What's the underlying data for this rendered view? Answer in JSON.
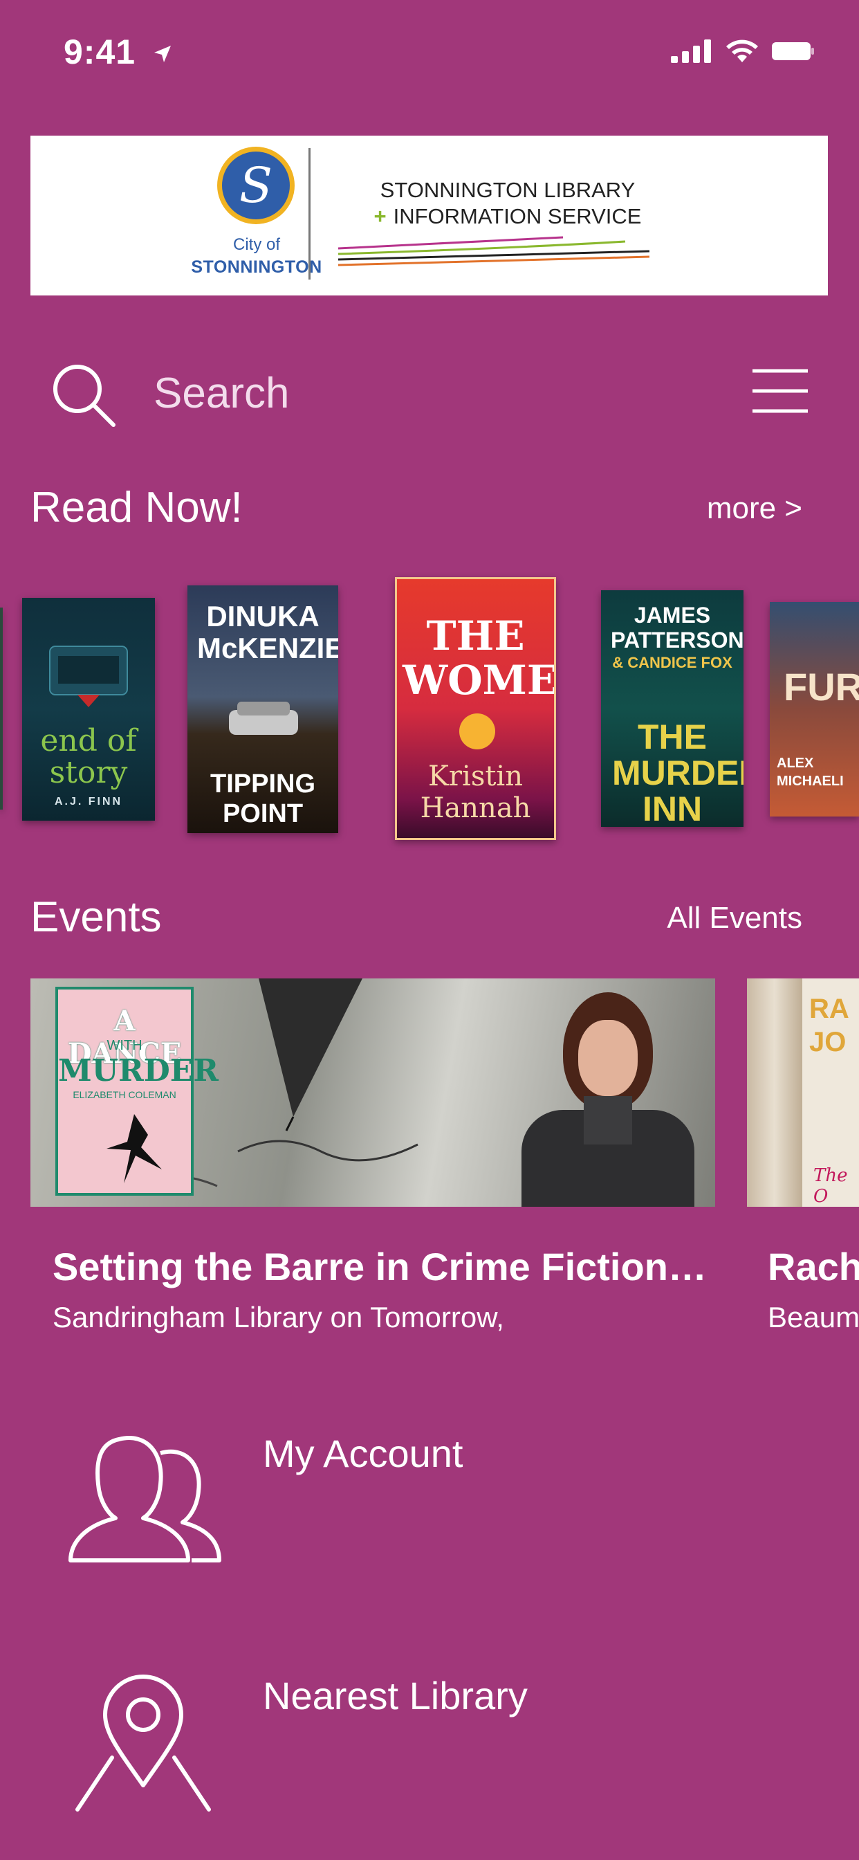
{
  "status_bar": {
    "time": "9:41"
  },
  "banner": {
    "city_letter": "S",
    "city_of": "City of",
    "city_name": "STONNINGTON",
    "library_line1": "STONNINGTON LIBRARY",
    "library_plus": "+",
    "library_line2": "INFORMATION SERVICE"
  },
  "search": {
    "placeholder": "Search"
  },
  "read_now": {
    "title": "Read Now!",
    "more_label": "more >",
    "books": [
      {
        "title_top": "",
        "title_main": "end of story",
        "author": "A.J. FINN"
      },
      {
        "title_top": "DINUKA McKENZIE",
        "title_main": "TIPPING POINT",
        "author": ""
      },
      {
        "title_top": "THE WOMEN",
        "title_main": "Kristin Hannah",
        "author": ""
      },
      {
        "title_top": "JAMES PATTERSON",
        "subtitle": "& CANDICE FOX",
        "title_main": "THE MURDER INN",
        "author": ""
      },
      {
        "title_top": "FUR",
        "title_main": "ALEX MICHAELI",
        "author": ""
      }
    ]
  },
  "events": {
    "title": "Events",
    "all_label": "All Events",
    "items": [
      {
        "title": "Setting the Barre in Crime Fiction…",
        "subtitle": "Sandringham Library on Tomorrow,",
        "book_cover": {
          "line1": "A DANCE",
          "line2": "WITH",
          "line3": "MURDER",
          "author": "ELIZABETH COLEMAN"
        }
      },
      {
        "title": "Rach",
        "subtitle": "Beaum",
        "book_cover": {
          "line1": "RA",
          "line2": "JO",
          "line3": "The O"
        }
      }
    ]
  },
  "nav": {
    "my_account": "My Account",
    "nearest_library": "Nearest Library"
  },
  "colors": {
    "background": "#a1377a",
    "text": "#ffffff"
  }
}
